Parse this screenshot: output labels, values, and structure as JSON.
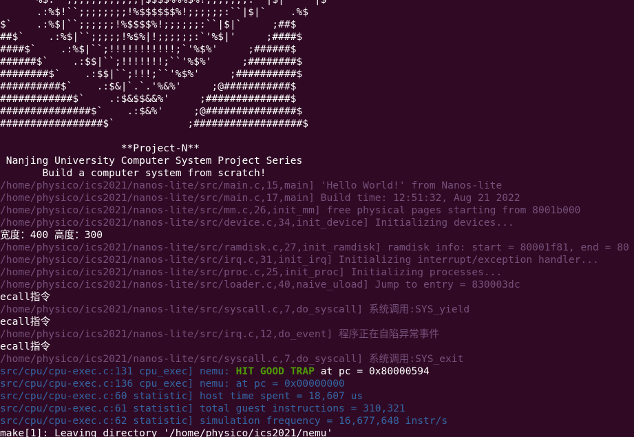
{
  "colors": {
    "background": "#300a24",
    "white": "#ffffff",
    "log_purple": "#75507b",
    "blue": "#3465a4",
    "green": "#4e9a06"
  },
  "lines": [
    [
      {
        "t": "      %$:  ;;;;;;;;;;;;|$$$$%%%$%!;;;;;;;:  |$|     |$",
        "c": "white"
      }
    ],
    [
      {
        "t": "      .:%$!``;;;;;;;;!%$$$$$$%!;;;;;;:``|$|`    .%$",
        "c": "white"
      }
    ],
    [
      {
        "t": "$`    .:%$|``;;;;;;!%$$$$%!;;;;;;:``|$|`     ;##$",
        "c": "white"
      }
    ],
    [
      {
        "t": "##$`    .:%$|``;;;;;!%$%|!;;;;;;:`'%$|'     ;####$",
        "c": "white"
      }
    ],
    [
      {
        "t": "####$`    .:%$|``;!!!!!!!!!!!;`'%$%'     ;######$",
        "c": "white"
      }
    ],
    [
      {
        "t": "######$`    .:$$|``;!!!!!!!;``'%$%'     ;########$",
        "c": "white"
      }
    ],
    [
      {
        "t": "########$`    .:$$|``;!!!;``'%$%'     ;##########$",
        "c": "white"
      }
    ],
    [
      {
        "t": "##########$`    .:$&|`.`.'%&%'     ;@###########$",
        "c": "white"
      }
    ],
    [
      {
        "t": "############$`    .:$&$$&&%'     ;##############$",
        "c": "white"
      }
    ],
    [
      {
        "t": "###############$`    .:$&%'     ;@###############$",
        "c": "white"
      }
    ],
    [
      {
        "t": "#################$`            ;##################$",
        "c": "white"
      }
    ],
    [
      {
        "t": "",
        "c": "white"
      }
    ],
    [
      {
        "t": "                    **Project-N**",
        "c": "white"
      }
    ],
    [
      {
        "t": " Nanjing University Computer System Project Series",
        "c": "white"
      }
    ],
    [
      {
        "t": "       Build a computer system from scratch!",
        "c": "white"
      }
    ],
    [
      {
        "t": "/home/physico/ics2021/nanos-lite/src/main.c,15,main] 'Hello World!' from Nanos-lite",
        "c": "log_purple"
      }
    ],
    [
      {
        "t": "/home/physico/ics2021/nanos-lite/src/main.c,17,main] Build time: 12:51:32, Aug 21 2022",
        "c": "log_purple"
      }
    ],
    [
      {
        "t": "/home/physico/ics2021/nanos-lite/src/mm.c,26,init_mm] free physical pages starting from 8001b000",
        "c": "log_purple"
      }
    ],
    [
      {
        "t": "/home/physico/ics2021/nanos-lite/src/device.c,34,init_device] Initializing devices...",
        "c": "log_purple"
      }
    ],
    [
      {
        "t": "宽度：400 高度：300",
        "c": "white"
      }
    ],
    [
      {
        "t": "/home/physico/ics2021/nanos-lite/src/ramdisk.c,27,init_ramdisk] ramdisk info: start = 80001f81, end = 80",
        "c": "log_purple"
      }
    ],
    [
      {
        "t": "/home/physico/ics2021/nanos-lite/src/irq.c,31,init_irq] Initializing interrupt/exception handler...",
        "c": "log_purple"
      }
    ],
    [
      {
        "t": "/home/physico/ics2021/nanos-lite/src/proc.c,25,init_proc] Initializing processes...",
        "c": "log_purple"
      }
    ],
    [
      {
        "t": "/home/physico/ics2021/nanos-lite/src/loader.c,40,naive_uload] Jump to entry = 830003dc",
        "c": "log_purple"
      }
    ],
    [
      {
        "t": "ecall指令",
        "c": "white"
      }
    ],
    [
      {
        "t": "/home/physico/ics2021/nanos-lite/src/syscall.c,7,do_syscall] 系统调用:SYS_yield",
        "c": "log_purple"
      }
    ],
    [
      {
        "t": "ecall指令",
        "c": "white"
      }
    ],
    [
      {
        "t": "/home/physico/ics2021/nanos-lite/src/irq.c,12,do_event] 程序正在自陷异常事件",
        "c": "log_purple"
      }
    ],
    [
      {
        "t": "ecall指令",
        "c": "white"
      }
    ],
    [
      {
        "t": "/home/physico/ics2021/nanos-lite/src/syscall.c,7,do_syscall] 系统调用:SYS_exit",
        "c": "log_purple"
      }
    ],
    [
      {
        "t": "src/cpu/cpu-exec.c:131 cpu_exec] nemu: ",
        "c": "blue"
      },
      {
        "t": "HIT GOOD TRAP",
        "c": "green",
        "bold": true
      },
      {
        "t": " at pc = 0x80000594",
        "c": "white"
      }
    ],
    [
      {
        "t": "src/cpu/cpu-exec.c:136 cpu_exec] nemu: at pc = 0x00000000",
        "c": "blue"
      }
    ],
    [
      {
        "t": "src/cpu/cpu-exec.c:60 statistic] host time spent = 18,607 us",
        "c": "blue"
      }
    ],
    [
      {
        "t": "src/cpu/cpu-exec.c:61 statistic] total guest instructions = 310,321",
        "c": "blue"
      }
    ],
    [
      {
        "t": "src/cpu/cpu-exec.c:62 statistic] simulation frequency = 16,677,648 instr/s",
        "c": "blue"
      }
    ],
    [
      {
        "t": "make[1]: Leaving directory '/home/physico/ics2021/nemu'",
        "c": "white"
      }
    ]
  ]
}
